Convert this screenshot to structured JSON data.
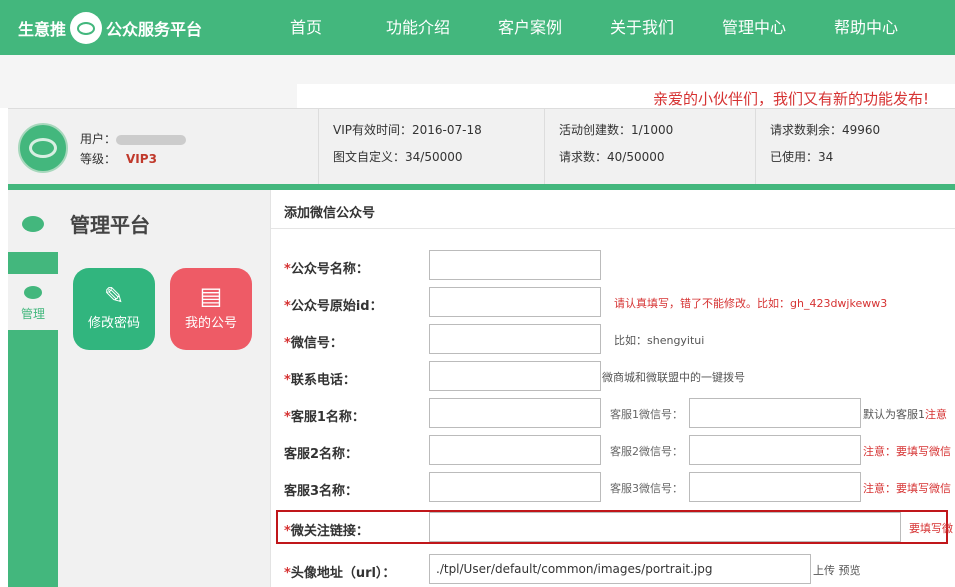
{
  "header": {
    "logo_left": "生意推",
    "logo_right": "公众服务平台",
    "nav": [
      "首页",
      "功能介绍",
      "客户案例",
      "关于我们",
      "管理中心",
      "帮助中心"
    ]
  },
  "notice": "亲爱的小伙伴们，我们又有新的功能发布!",
  "user": {
    "user_label": "用户：",
    "level_label": "等级：",
    "level_value": "VIP3"
  },
  "stats": {
    "vip_expire": "VIP有效时间：2016-07-18",
    "news_custom": "图文自定义：34/50000",
    "activity_count": "活动创建数：1/1000",
    "request_count": "请求数：40/50000",
    "request_remaining": "请求数剩余：49960",
    "used": "已使用：34"
  },
  "sidebar": {
    "title": "管理平台",
    "tab_label": "管理",
    "tiles": [
      {
        "label": "修改密码",
        "icon": "pencil-icon"
      },
      {
        "label": "我的公号",
        "icon": "certificate-icon"
      }
    ]
  },
  "form": {
    "title": "添加微信公众号",
    "fields": {
      "name": {
        "label": "公众号名称：",
        "required": true,
        "value": ""
      },
      "origin_id": {
        "label": "公众号原始id：",
        "required": true,
        "value": "",
        "hint": "请认真填写，错了不能修改。比如：gh_423dwjkeww3"
      },
      "wechat_id": {
        "label": "微信号：",
        "required": true,
        "value": "",
        "hint": "比如：shengyitui"
      },
      "phone": {
        "label": "联系电话：",
        "required": true,
        "value": "",
        "hint": "微商城和微联盟中的一键拨号"
      },
      "cs1": {
        "label": "客服1名称：",
        "required": true,
        "value": "",
        "sub_label": "客服1微信号：",
        "sub_value": "",
        "hint_a": "默认为客服1",
        "hint_b": "注意"
      },
      "cs2": {
        "label": "客服2名称：",
        "required": false,
        "value": "",
        "sub_label": "客服2微信号：",
        "sub_value": "",
        "hint": "注意：要填写微信"
      },
      "cs3": {
        "label": "客服3名称：",
        "required": false,
        "value": "",
        "sub_label": "客服3微信号：",
        "sub_value": "",
        "hint": "注意：要填写微信"
      },
      "follow_link": {
        "label": "微关注链接：",
        "required": true,
        "value": "",
        "hint": "要填写微"
      },
      "avatar_url": {
        "label": "头像地址（url）：",
        "required": true,
        "value": "./tpl/User/default/common/images/portrait.jpg",
        "upload": "上传",
        "preview": "预览"
      }
    }
  },
  "colors": {
    "brand_green": "#43b77d",
    "accent_red": "#d63333",
    "tile_pink": "#ee5b66"
  }
}
